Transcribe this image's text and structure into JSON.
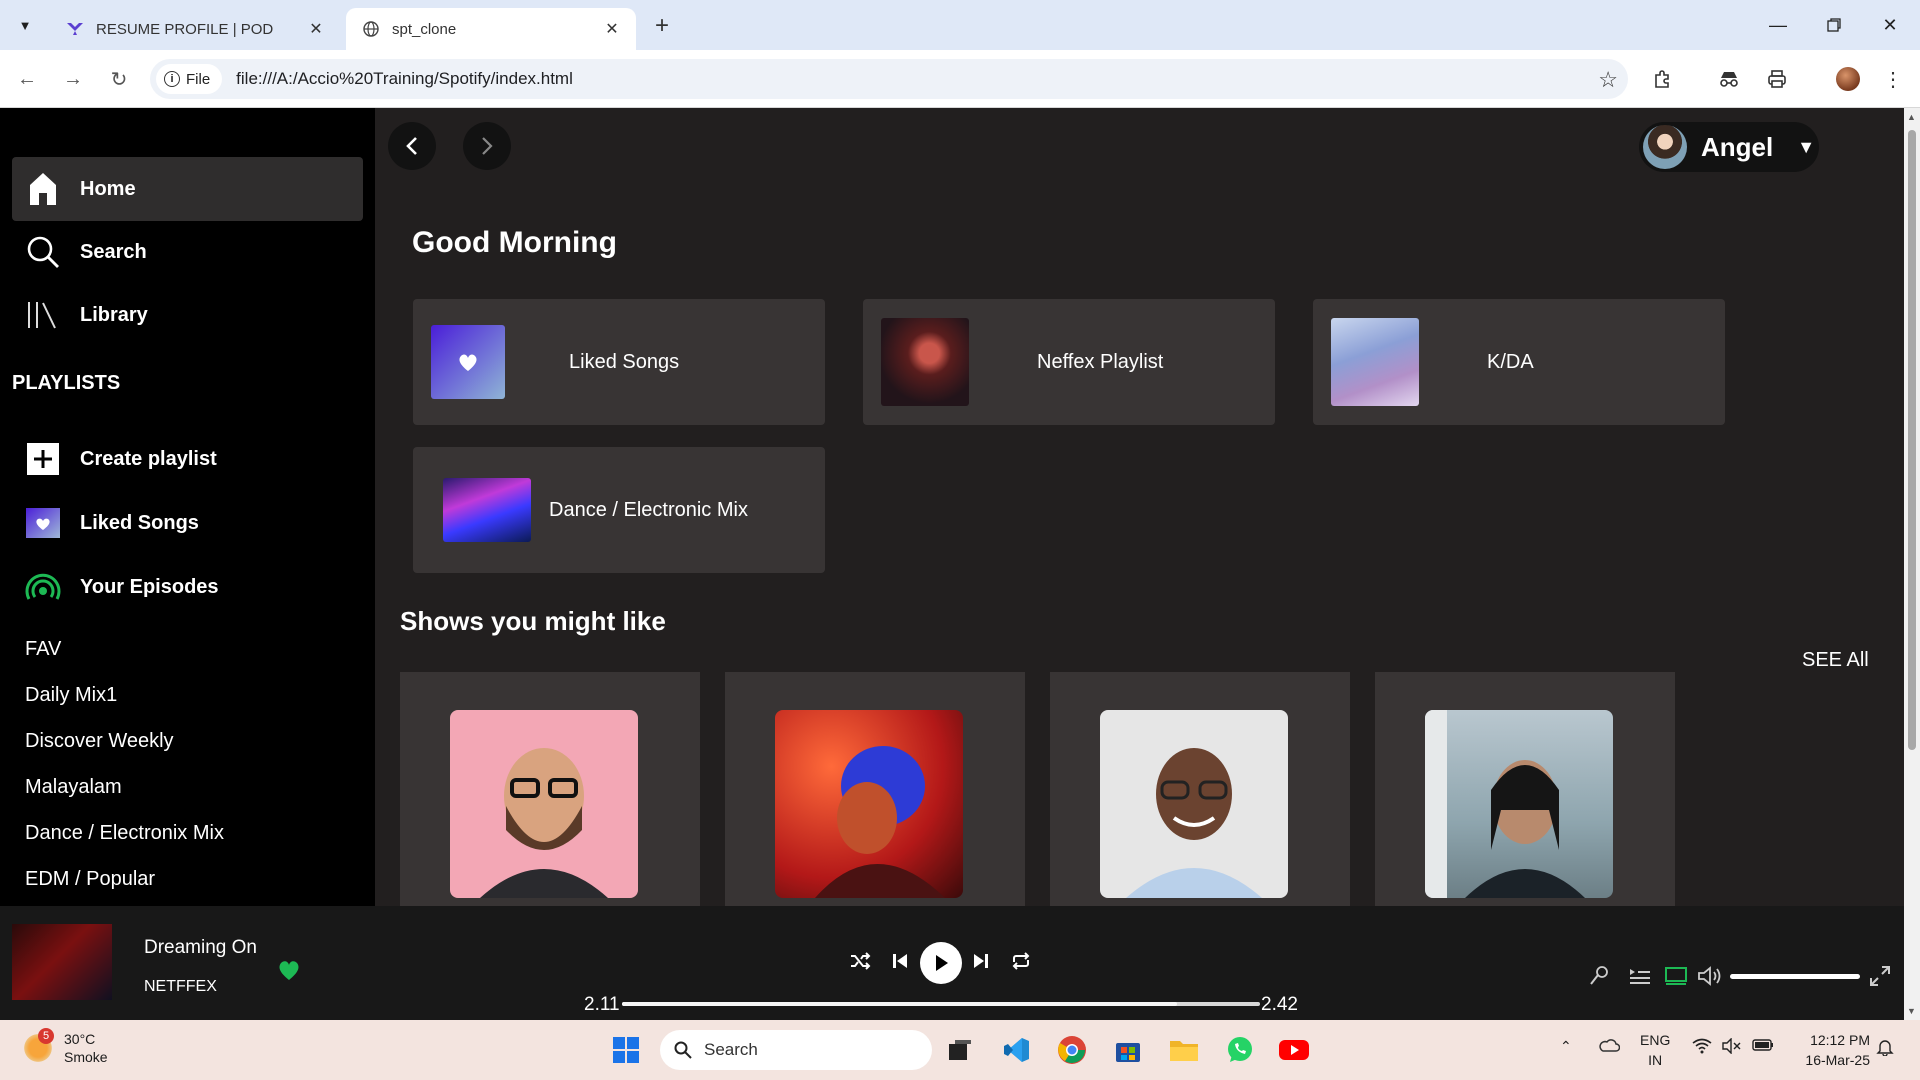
{
  "browser": {
    "tabs": [
      {
        "title": "RESUME PROFILE | POD",
        "active": false
      },
      {
        "title": "spt_clone",
        "active": true
      }
    ],
    "address": {
      "scheme_chip": "File",
      "url": "file:///A:/Accio%20Training/Spotify/index.html"
    }
  },
  "sidebar": {
    "nav": [
      {
        "label": "Home",
        "icon": "home-icon",
        "active": true
      },
      {
        "label": "Search",
        "icon": "search-icon",
        "active": false
      },
      {
        "label": "Library",
        "icon": "library-icon",
        "active": false
      }
    ],
    "playlists_heading": "PLAYLISTS",
    "actions": [
      {
        "label": "Create playlist",
        "icon": "plus-icon"
      },
      {
        "label": "Liked Songs",
        "icon": "heart-icon"
      },
      {
        "label": "Your Episodes",
        "icon": "podcast-icon"
      }
    ],
    "playlists": [
      "FAV",
      "Daily Mix1",
      "Discover Weekly",
      "Malayalam",
      "Dance / Electronix Mix",
      "EDM / Popular"
    ]
  },
  "header": {
    "user_name": "Angel"
  },
  "main": {
    "greeting": "Good Morning",
    "quick_picks": [
      {
        "label": "Liked Songs"
      },
      {
        "label": "Neffex Playlist"
      },
      {
        "label": "K/DA"
      },
      {
        "label": "Dance / Electronic Mix"
      }
    ],
    "shows_heading": "Shows you might like",
    "see_all": "SEE All"
  },
  "player": {
    "title": "Dreaming On",
    "artist": "NETFFEX",
    "elapsed": "2.11",
    "duration": "2.42",
    "progress": 0.87,
    "volume": 1.0,
    "colors": {
      "heart": "#1db954",
      "device": "#1db954"
    }
  },
  "taskbar": {
    "weather_temp": "30°C",
    "weather_desc": "Smoke",
    "weather_badge": "5",
    "search_label": "Search",
    "lang_top": "ENG",
    "lang_bottom": "IN",
    "time": "12:12 PM",
    "date": "16-Mar-25"
  }
}
